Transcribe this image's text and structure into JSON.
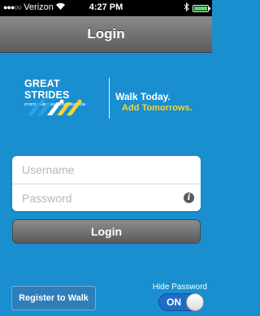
{
  "status_bar": {
    "carrier": "Verizon",
    "time": "4:27 PM",
    "battery_level": 1.0,
    "icons": [
      "signal-dots",
      "wifi-icon",
      "bluetooth-icon",
      "battery-icon"
    ]
  },
  "nav": {
    "title": "Login"
  },
  "logo": {
    "brand_line1": "GREAT STRIDES",
    "brand_line2": "CYSTIC FIBROSIS FOUNDATION",
    "tagline1": "Walk Today.",
    "tagline2": "Add Tomorrows.",
    "tagline2_color": "#f6d33a"
  },
  "form": {
    "username_placeholder": "Username",
    "password_placeholder": "Password",
    "login_label": "Login"
  },
  "footer": {
    "register_label": "Register to Walk",
    "hide_password_label": "Hide Password",
    "toggle_state": "ON"
  },
  "colors": {
    "background": "#1a8fd0",
    "toggle_on": "#1e6cc8"
  }
}
